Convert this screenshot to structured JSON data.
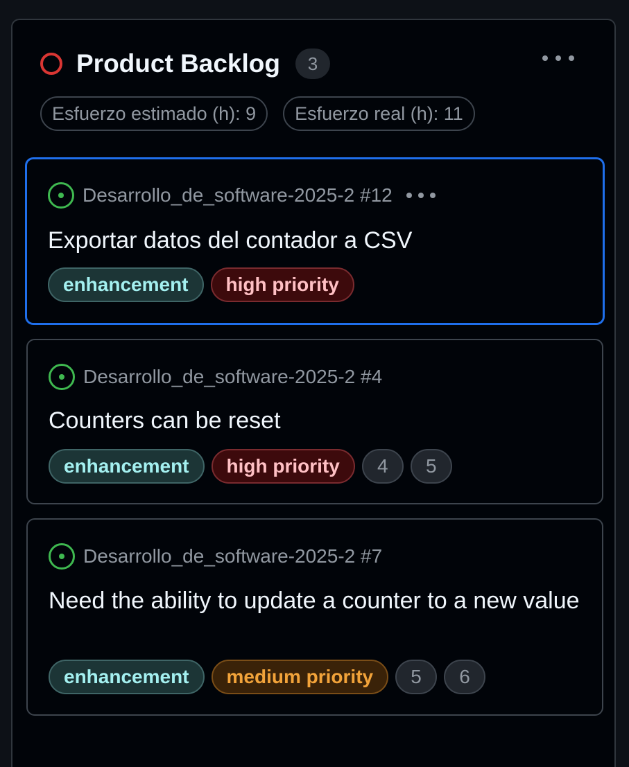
{
  "column": {
    "title": "Product Backlog",
    "count": "3",
    "status_color": "#da3633",
    "field_sums": [
      "Esfuerzo estimado (h): 9",
      "Esfuerzo real (h): 11"
    ]
  },
  "cards": [
    {
      "selected": true,
      "icon": "issue-open-icon",
      "repo": "Desarrollo_de_software-2025-2",
      "number": "#12",
      "title": "Exportar datos del contador a CSV",
      "labels": [
        "enhancement",
        "high priority"
      ],
      "fields": []
    },
    {
      "selected": false,
      "icon": "issue-open-icon",
      "repo": "Desarrollo_de_software-2025-2",
      "number": "#4",
      "title": "Counters can be reset",
      "labels": [
        "enhancement",
        "high priority"
      ],
      "fields": [
        "4",
        "5"
      ]
    },
    {
      "selected": false,
      "icon": "issue-open-icon",
      "repo": "Desarrollo_de_software-2025-2",
      "number": "#7",
      "title": "Need the ability to update a counter to a new value",
      "labels": [
        "enhancement",
        "medium priority"
      ],
      "fields": [
        "5",
        "6"
      ]
    }
  ],
  "colors": {
    "accent_selected": "#1f6feb",
    "issue_open": "#3fb950",
    "label_enhancement": "#a4f0f0",
    "label_high_priority": "#ffc0c4",
    "label_medium_priority": "#f2a33a"
  }
}
